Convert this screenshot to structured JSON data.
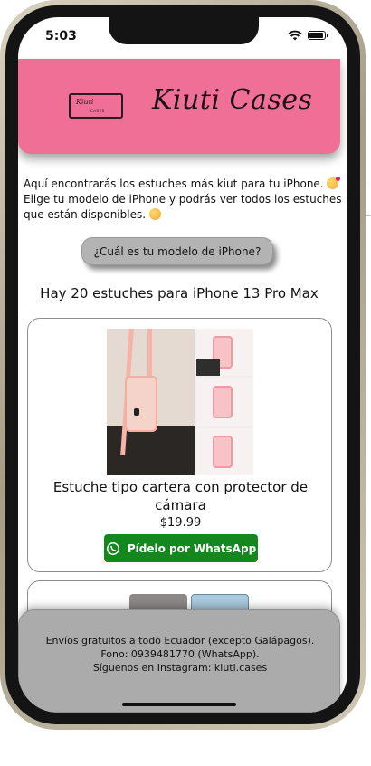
{
  "status_bar": {
    "time": "5:03"
  },
  "header": {
    "logo_text": "Kiuti",
    "logo_sub": "CASES",
    "brand_title": "Kiuti Cases"
  },
  "intro": {
    "line": "Aquí encontrarás los estuches más kiut para tu iPhone.",
    "line2": "Elige tu modelo de iPhone y podrás ver todos los estuches que están disponibles."
  },
  "model_button_label": "¿Cuál es tu modelo de iPhone?",
  "count_text": "Hay 20 estuches para iPhone 13 Pro Max",
  "products": [
    {
      "title": "Estuche tipo cartera con protector de cámara",
      "price": "$19.99",
      "button_label": "Pídelo por WhatsApp"
    }
  ],
  "footer": {
    "line1": "Envíos gratuitos a todo Ecuador (excepto Galápagos).",
    "line2": "Fono: 0939481770 (WhatsApp).",
    "line3": "Síguenos en Instagram: kiuti.cases"
  },
  "colors": {
    "header_pink": "#ef6f96",
    "whatsapp_green": "#14871f",
    "footer_gray": "#ababab",
    "button_gray": "#b3b3b3"
  },
  "icons": [
    "wifi-icon",
    "battery-icon",
    "whatsapp-icon",
    "smiling-face-with-hearts-emoji",
    "hugging-face-emoji"
  ]
}
